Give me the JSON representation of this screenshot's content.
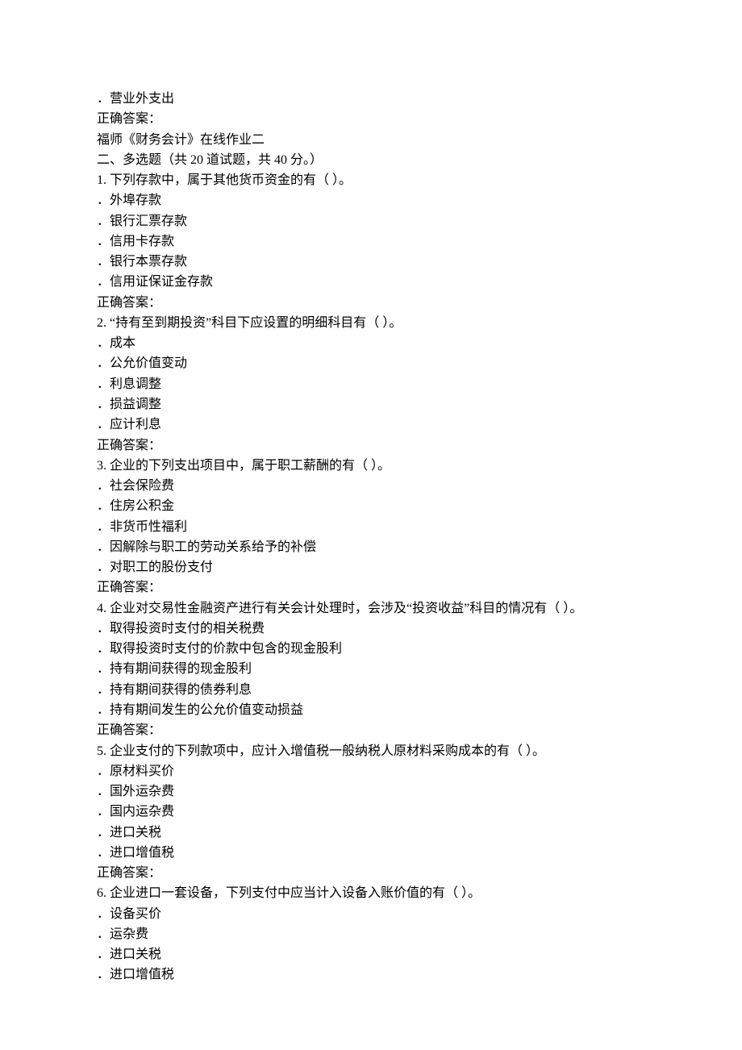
{
  "pre_option": "．营业外支出",
  "pre_answer": "正确答案：",
  "title": "福师《财务会计》在线作业二",
  "section_header": "二、多选题（共 20 道试题，共 40 分。）",
  "answer_label": "正确答案：",
  "questions": [
    {
      "num": "1.",
      "text": "  下列存款中，属于其他货币资金的有（ ）。",
      "options": [
        "．外埠存款",
        "．银行汇票存款",
        "．信用卡存款",
        "．银行本票存款",
        "．信用证保证金存款"
      ]
    },
    {
      "num": "2.",
      "text": "  “持有至到期投资”科目下应设置的明细科目有（ ）。",
      "options": [
        "．成本",
        "．公允价值变动",
        "．利息调整",
        "．损益调整",
        "．应计利息"
      ]
    },
    {
      "num": "3.",
      "text": "  企业的下列支出项目中，属于职工薪酬的有（ ）。",
      "options": [
        "．社会保险费",
        "．住房公积金",
        "．非货币性福利",
        "．因解除与职工的劳动关系给予的补偿",
        "．对职工的股份支付"
      ]
    },
    {
      "num": "4.",
      "text": "  企业对交易性金融资产进行有关会计处理时，会涉及“投资收益”科目的情况有（ ）。",
      "options": [
        "．取得投资时支付的相关税费",
        "．取得投资时支付的价款中包含的现金股利",
        "．持有期间获得的现金股利",
        "．持有期间获得的债券利息",
        "．持有期间发生的公允价值变动损益"
      ]
    },
    {
      "num": "5.",
      "text": "  企业支付的下列款项中，应计入增值税一般纳税人原材料采购成本的有（ ）。",
      "options": [
        "．原材料买价",
        "．国外运杂费",
        "．国内运杂费",
        "．进口关税",
        "．进口增值税"
      ]
    },
    {
      "num": "6.",
      "text": "  企业进口一套设备，下列支付中应当计入设备入账价值的有（ ）。",
      "options": [
        "．设备买价",
        "．运杂费",
        "．进口关税",
        "．进口增值税"
      ]
    }
  ]
}
